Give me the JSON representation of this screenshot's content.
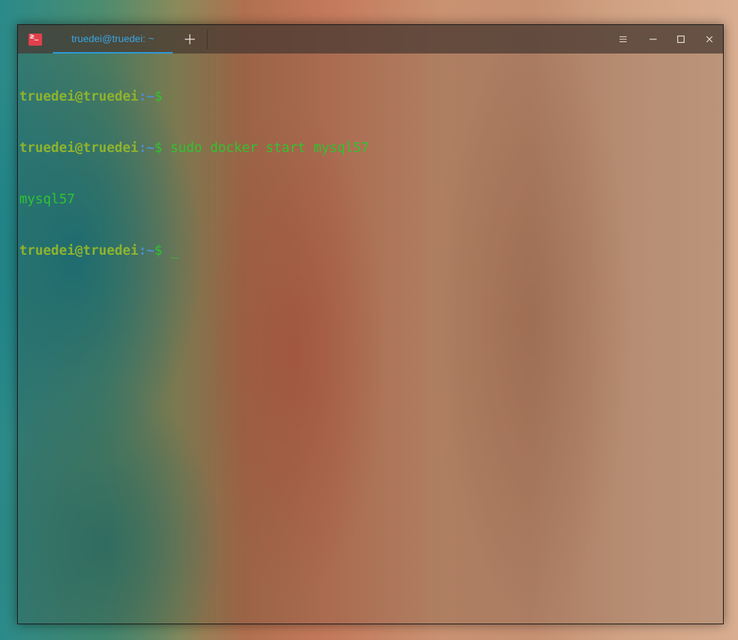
{
  "window": {
    "app_icon_glyph": "≥_",
    "tab_title": "truedei@truedei: ~",
    "buttons": {
      "new_tab_icon": "plus-icon",
      "menu_icon": "hamburger-icon",
      "minimize_icon": "minimize-icon",
      "maximize_icon": "maximize-icon",
      "close_icon": "close-icon"
    }
  },
  "terminal": {
    "lines": [
      {
        "user": "truedei@truedei",
        "sep": ":",
        "path": "~",
        "dollar": "$",
        "cmd": ""
      },
      {
        "user": "truedei@truedei",
        "sep": ":",
        "path": "~",
        "dollar": "$",
        "cmd": " sudo docker start mysql57"
      },
      {
        "output": "mysql57"
      },
      {
        "user": "truedei@truedei",
        "sep": ":",
        "path": "~",
        "dollar": "$",
        "cmd": " ",
        "cursor": "_"
      }
    ]
  },
  "colors": {
    "tab_accent": "#2e9bdc",
    "prompt_user": "#8fb32e",
    "prompt_path": "#4a8fd0",
    "text_green": "#2fc42f",
    "app_icon_bg": "#e0404b"
  }
}
